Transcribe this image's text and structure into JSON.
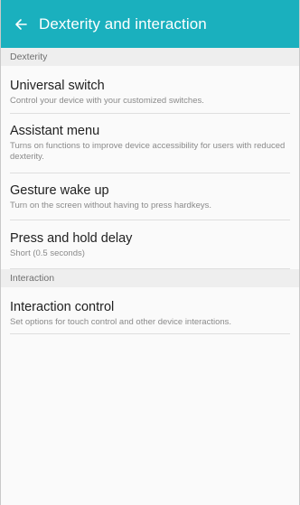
{
  "header": {
    "title": "Dexterity and interaction",
    "back_icon": "arrow-left-icon",
    "color": "#1ab0be"
  },
  "sections": [
    {
      "label": "Dexterity",
      "items": [
        {
          "title": "Universal switch",
          "subtitle": "Control your device with your customized switches."
        },
        {
          "title": "Assistant menu",
          "subtitle": "Turns on functions to improve device accessibility for users with reduced dexterity."
        },
        {
          "title": "Gesture wake up",
          "subtitle": "Turn on the screen without having to press hardkeys."
        },
        {
          "title": "Press and hold delay",
          "subtitle": "Short (0.5 seconds)"
        }
      ]
    },
    {
      "label": "Interaction",
      "items": [
        {
          "title": "Interaction control",
          "subtitle": "Set options for touch control and other device interactions."
        }
      ]
    }
  ]
}
